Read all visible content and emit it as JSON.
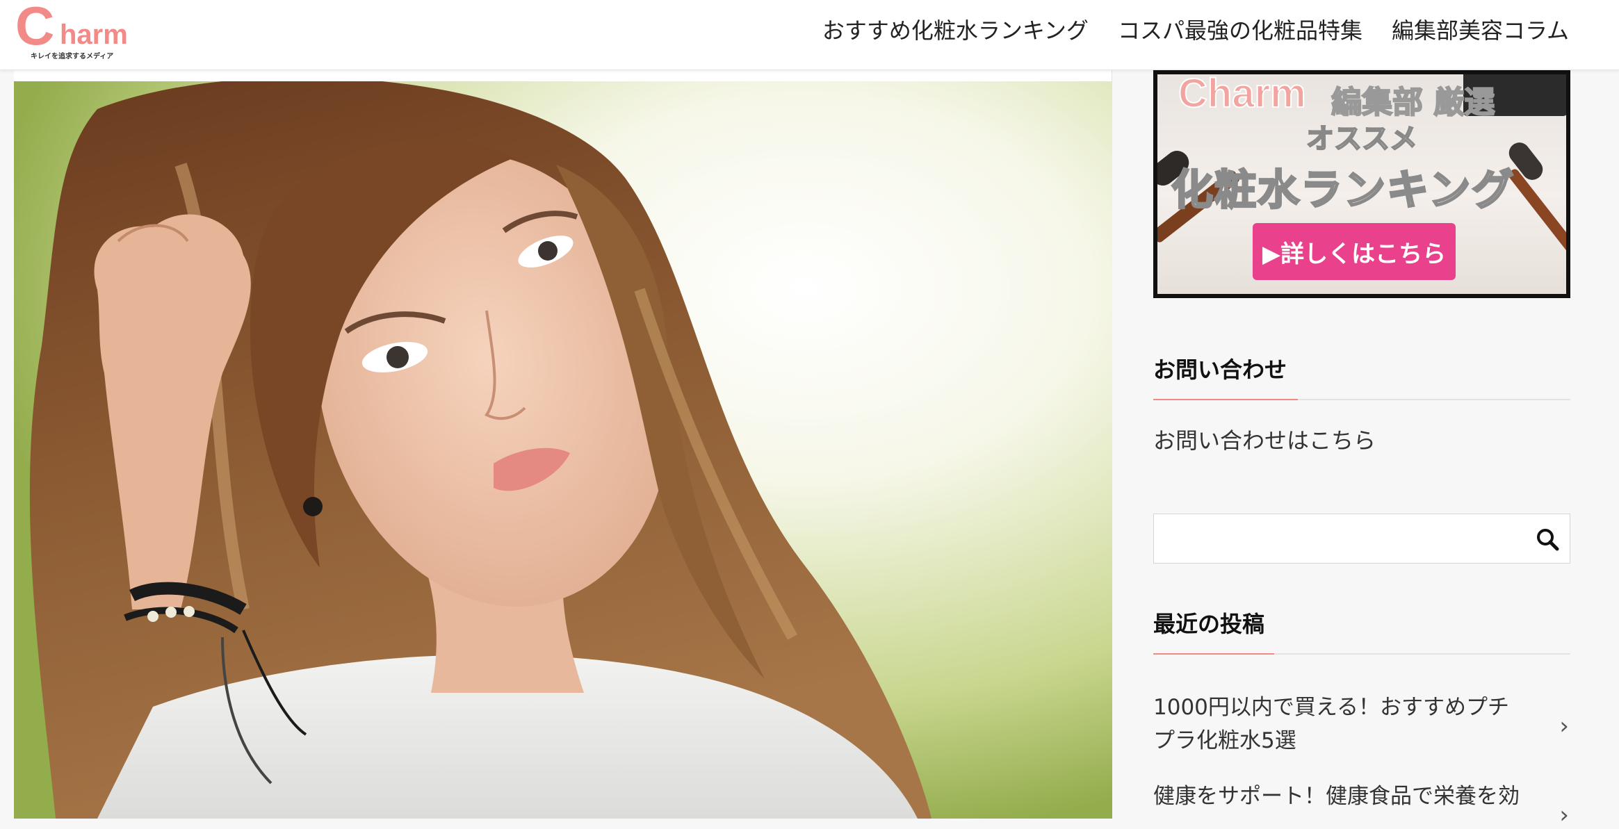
{
  "header": {
    "logo_letter": "C",
    "logo_word": "harm",
    "logo_tagline": "キレイを追求するメディア",
    "nav": [
      "おすすめ化粧水ランキング",
      "コスパ最強の化粧品特集",
      "編集部美容コラム"
    ]
  },
  "colors": {
    "accent": "#ef8a84",
    "cta_pink": "#e9418c"
  },
  "sidebar": {
    "banner": {
      "brand": "Charm",
      "dept": "編集部 厳選",
      "osusume": "オススメ",
      "ranking": "化粧水ランキング",
      "cta": "▶詳しくはこちら"
    },
    "contact": {
      "title": "お問い合わせ",
      "link": "お問い合わせはこちら"
    },
    "search": {
      "placeholder": ""
    },
    "recent": {
      "title": "最近の投稿",
      "posts": [
        "1000円以内で買える！おすすめプチプラ化粧水5選",
        "健康をサポート！健康食品で栄養を効"
      ]
    }
  }
}
